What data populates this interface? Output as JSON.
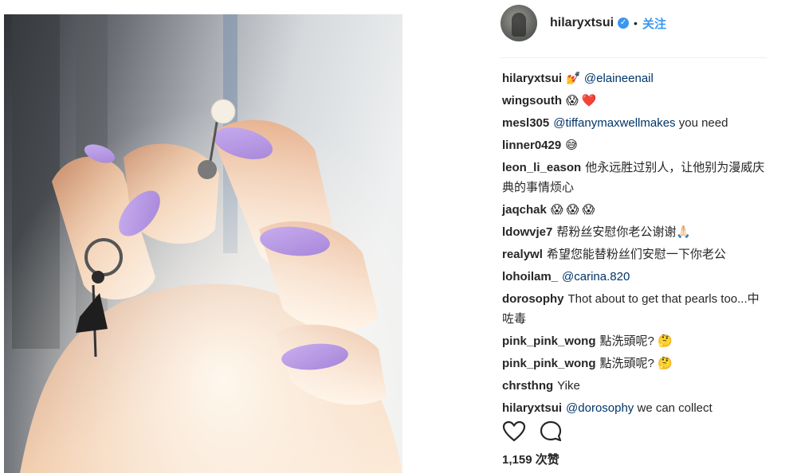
{
  "post": {
    "photo_alt_icon": "photo-of-hand-with-lilac-nails-and-pearl-earring"
  },
  "header": {
    "username": "hilaryxtsui",
    "verified_icon": "verified-badge-icon",
    "separator": "•",
    "follow_label": "关注"
  },
  "comments": [
    {
      "user": "hilaryxtsui",
      "mention": "@elaineenail",
      "text": "",
      "emoji_prefix": "💅 "
    },
    {
      "user": "wingsouth",
      "mention": "",
      "text": "😱 ❤️"
    },
    {
      "user": "mesl305",
      "mention": "@tiffanymaxwellmakes",
      "text": " you need"
    },
    {
      "user": "linner0429",
      "mention": "",
      "text": "😅"
    },
    {
      "user": "leon_li_eason",
      "mention": "",
      "text": "他永远胜过别人，让他别为漫威庆典的事情烦心"
    },
    {
      "user": "jaqchak",
      "mention": "",
      "text": "😱 😱 😱"
    },
    {
      "user": "ldowvje7",
      "mention": "",
      "text": "帮粉丝安慰你老公谢谢🙏🏻"
    },
    {
      "user": "realywl",
      "mention": "",
      "text": "希望您能替粉丝们安慰一下你老公"
    },
    {
      "user": "lohoilam_",
      "mention": "@carina.820",
      "text": ""
    },
    {
      "user": "dorosophy",
      "mention": "",
      "text": "Thot about to get that pearls too...中咗毒"
    },
    {
      "user": "pink_pink_wong",
      "mention": "",
      "text": "點洗頭呢? 🤔"
    },
    {
      "user": "pink_pink_wong",
      "mention": "",
      "text": "點洗頭呢? 🤔"
    },
    {
      "user": "chrsthng",
      "mention": "",
      "text": "Yike"
    },
    {
      "user": "hilaryxtsui",
      "mention": "@dorosophy",
      "text": " we can collect"
    }
  ],
  "actions": {
    "like_icon": "heart-icon",
    "comment_icon": "comment-bubble-icon"
  },
  "likes": {
    "count_label": "1,159 次赞"
  },
  "colors": {
    "accent": "#3897f0",
    "mention": "#003569",
    "nail": "#b79be0"
  }
}
